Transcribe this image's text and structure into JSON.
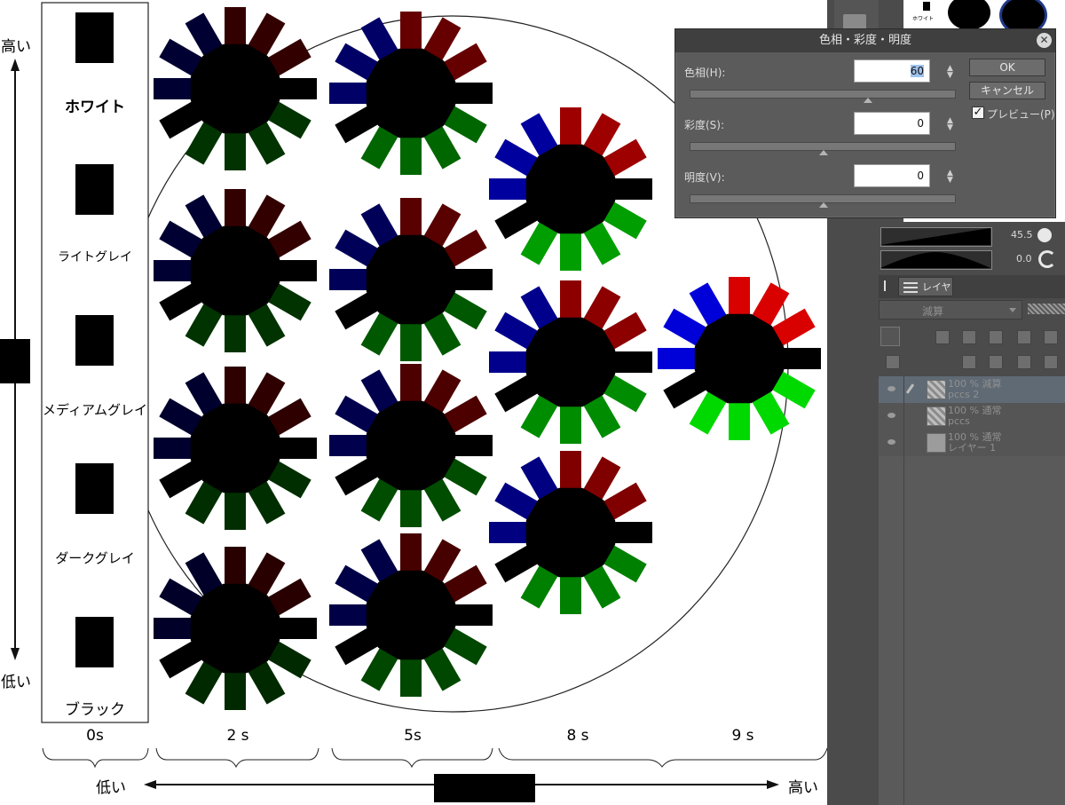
{
  "canvas": {
    "chips": [
      "ホワイト",
      "ライトグレイ",
      "メディアムグレイ",
      "ダークグレイ",
      "ブラック"
    ],
    "vertical_axis": {
      "top": "高い",
      "bottom": "低い"
    },
    "horizontal_axis": {
      "left": "低い",
      "right": "高い"
    },
    "columns": [
      "0s",
      "2 s",
      "5s",
      "8 s",
      "9 s"
    ]
  },
  "dialog": {
    "title": "色相・彩度・明度",
    "hue_label": "色相(H):",
    "hue_value": "60",
    "saturation_label": "彩度(S):",
    "saturation_value": "0",
    "value_label": "明度(V):",
    "value_value": "0",
    "ok_label": "OK",
    "cancel_label": "キャンセル",
    "preview_label": "プレビュー(P)",
    "close_glyph": "✕",
    "check_glyph": "✓",
    "spin_glyph": "▲▼"
  },
  "right_panel": {
    "preview_chip_label": "ホワイト",
    "zoom_value": "45.5",
    "rotate_value": "0.0",
    "layer_tab": "レイヤー",
    "blend_mode": "減算",
    "layers": [
      {
        "line1": "100 % 減算",
        "line2": "pccs 2",
        "selected": true
      },
      {
        "line1": "100 % 通常",
        "line2": "pccs",
        "selected": false
      },
      {
        "line1": "100 % 通常",
        "line2": "レイヤー 1",
        "selected": false
      }
    ]
  }
}
